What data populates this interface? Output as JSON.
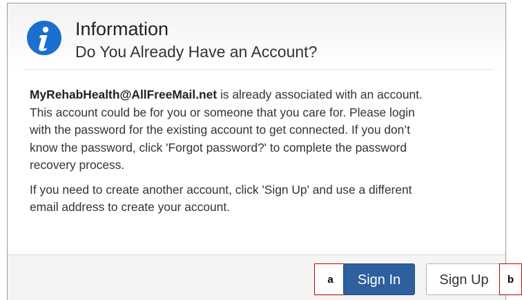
{
  "dialog": {
    "title": "Information",
    "subtitle": "Do You Already Have an Account?",
    "icon": "info-icon",
    "email": "MyRehabHealth@AllFreeMail.net",
    "paragraph1_lines": [
      " is already associated with an account.",
      "This account could be for you or someone that you care for. Please login",
      "with the password for the existing account to get connected. If you don’t",
      "know the password, click 'Forgot password?' to complete the password",
      "recovery process."
    ],
    "paragraph2_lines": [
      "If you need to create another account, click 'Sign Up' and use a different",
      "email address to create your account."
    ]
  },
  "buttons": {
    "sign_in": "Sign In",
    "sign_up": "Sign Up"
  },
  "callouts": {
    "a": "a",
    "b": "b"
  },
  "colors": {
    "icon_blue": "#1a6fd0",
    "primary_button": "#2e5f9e",
    "callout_border": "#c00000"
  }
}
